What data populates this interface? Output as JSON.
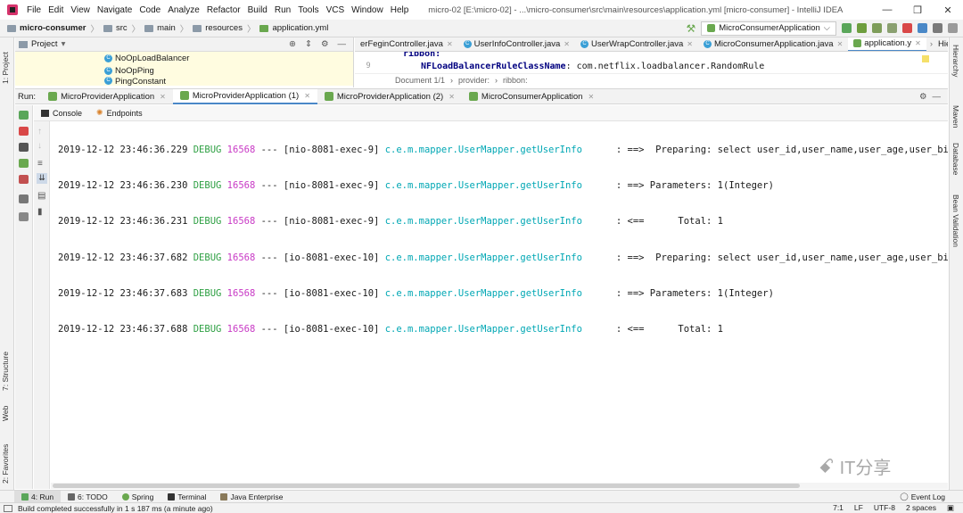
{
  "title_bar": {
    "menu": [
      "File",
      "Edit",
      "View",
      "Navigate",
      "Code",
      "Analyze",
      "Refactor",
      "Build",
      "Run",
      "Tools",
      "VCS",
      "Window",
      "Help"
    ],
    "window_title": "micro-02 [E:\\micro-02] - ...\\micro-consumer\\src\\main\\resources\\application.yml [micro-consumer] - IntelliJ IDEA",
    "controls": [
      "—",
      "❒",
      "✕"
    ]
  },
  "nav_bar": {
    "breadcrumbs": [
      "micro-consumer",
      "src",
      "main",
      "resources",
      "application.yml"
    ],
    "run_config": "MicroConsumerApplication"
  },
  "project_panel": {
    "title": "Project",
    "items": [
      "NoOpLoadBalancer",
      "NoOpPing",
      "PingConstant"
    ]
  },
  "editor": {
    "tabs": [
      {
        "label": "erFeginController.java"
      },
      {
        "label": "UserInfoController.java"
      },
      {
        "label": "UserWrapController.java"
      },
      {
        "label": "MicroConsumerApplication.java"
      },
      {
        "label": "application.y"
      },
      {
        "label": "Hiera"
      }
    ],
    "line_partial": "ribbon:",
    "line_number": "9",
    "line_key": "NFLoadBalancerRuleClassName",
    "line_value": ": com.netflix.loadbalancer.RandomRule",
    "doc_status": [
      "Document 1/1",
      "provider:",
      "ribbon:"
    ]
  },
  "left_stripe": {
    "labels": [
      "1: Project",
      "7: Structure",
      "Web",
      "2: Favorites"
    ]
  },
  "right_stripe": {
    "labels": [
      "Hierarchy",
      "Maven",
      "Database",
      "Bean Validation"
    ]
  },
  "run_panel": {
    "label": "Run:",
    "tabs": [
      {
        "label": "MicroProviderApplication"
      },
      {
        "label": "MicroProviderApplication (1)"
      },
      {
        "label": "MicroProviderApplication (2)"
      },
      {
        "label": "MicroConsumerApplication"
      }
    ],
    "subtabs": [
      "Console",
      "Endpoints"
    ]
  },
  "console_lines": [
    {
      "ts": "2019-12-12 23:46:36.229",
      "level": "DEBUG",
      "pid": "16568",
      "thread": " --- [nio-8081-exec-9] ",
      "logger": "c.e.m.mapper.UserMapper.getUserInfo",
      "msg": "      : ==>  Preparing: select user_id,user_name,user_age,user_birth"
    },
    {
      "ts": "2019-12-12 23:46:36.230",
      "level": "DEBUG",
      "pid": "16568",
      "thread": " --- [nio-8081-exec-9] ",
      "logger": "c.e.m.mapper.UserMapper.getUserInfo",
      "msg": "      : ==> Parameters: 1(Integer)"
    },
    {
      "ts": "2019-12-12 23:46:36.231",
      "level": "DEBUG",
      "pid": "16568",
      "thread": " --- [nio-8081-exec-9] ",
      "logger": "c.e.m.mapper.UserMapper.getUserInfo",
      "msg": "      : <==      Total: 1"
    },
    {
      "ts": "2019-12-12 23:46:37.682",
      "level": "DEBUG",
      "pid": "16568",
      "thread": " --- [io-8081-exec-10] ",
      "logger": "c.e.m.mapper.UserMapper.getUserInfo",
      "msg": "      : ==>  Preparing: select user_id,user_name,user_age,user_birth"
    },
    {
      "ts": "2019-12-12 23:46:37.683",
      "level": "DEBUG",
      "pid": "16568",
      "thread": " --- [io-8081-exec-10] ",
      "logger": "c.e.m.mapper.UserMapper.getUserInfo",
      "msg": "      : ==> Parameters: 1(Integer)"
    },
    {
      "ts": "2019-12-12 23:46:37.688",
      "level": "DEBUG",
      "pid": "16568",
      "thread": " --- [io-8081-exec-10] ",
      "logger": "c.e.m.mapper.UserMapper.getUserInfo",
      "msg": "      : <==      Total: 1"
    }
  ],
  "bottom_tools": [
    {
      "label": "4: Run",
      "icon": "run-icon"
    },
    {
      "label": "6: TODO",
      "icon": "todo-icon"
    },
    {
      "label": "Spring",
      "icon": "spring-icon"
    },
    {
      "label": "Terminal",
      "icon": "terminal-icon"
    },
    {
      "label": "Java Enterprise",
      "icon": "java-enterprise-icon"
    }
  ],
  "event_log": "Event Log",
  "status_bar": {
    "message": "Build completed successfully in 1 s 187 ms (a minute ago)",
    "position": "7:1",
    "line_sep": "LF",
    "encoding": "UTF-8",
    "indent": "2 spaces"
  },
  "watermark": "IT分享",
  "colors": {
    "debug": "#2ea043",
    "pid": "#c839c5",
    "logger": "#00a7b4",
    "accent": "#4a88c7"
  }
}
